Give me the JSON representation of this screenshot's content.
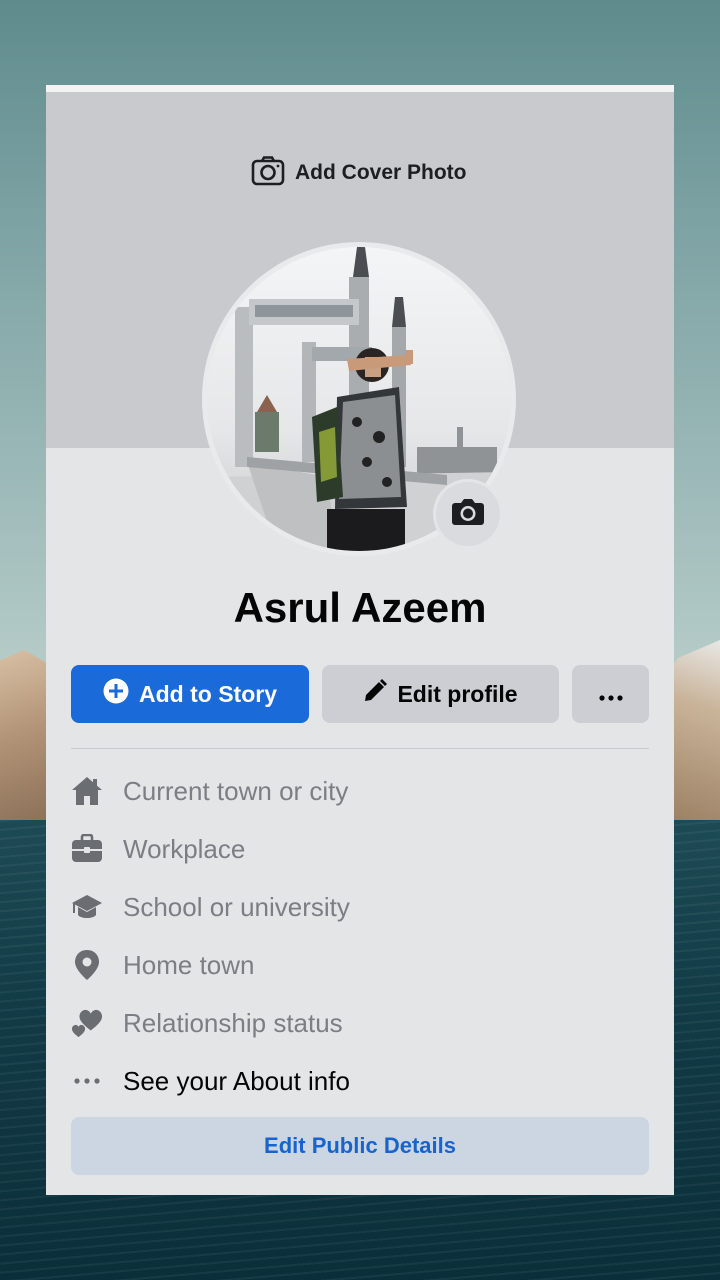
{
  "cover": {
    "add_cover_label": "Add Cover Photo"
  },
  "profile": {
    "name": "Asrul Azeem"
  },
  "actions": {
    "add_story_label": "Add to Story",
    "edit_profile_label": "Edit profile",
    "more_label": "•••"
  },
  "details": [
    {
      "icon": "house-icon",
      "label": "Current town or city"
    },
    {
      "icon": "briefcase-icon",
      "label": "Workplace"
    },
    {
      "icon": "graduation-cap-icon",
      "label": "School or university"
    },
    {
      "icon": "location-pin-icon",
      "label": "Home town"
    },
    {
      "icon": "hearts-icon",
      "label": "Relationship status"
    },
    {
      "icon": "more-dots-icon",
      "label": "See your About info"
    }
  ],
  "edit_public_label": "Edit Public Details",
  "colors": {
    "primary": "#1a6ad9",
    "secondary_button": "#ccced3",
    "card": "#e4e5e7",
    "cover": "#c9cace",
    "muted_text": "#7b7e84",
    "public_button_bg": "#cbd6e2",
    "public_button_text": "#1864cc"
  }
}
